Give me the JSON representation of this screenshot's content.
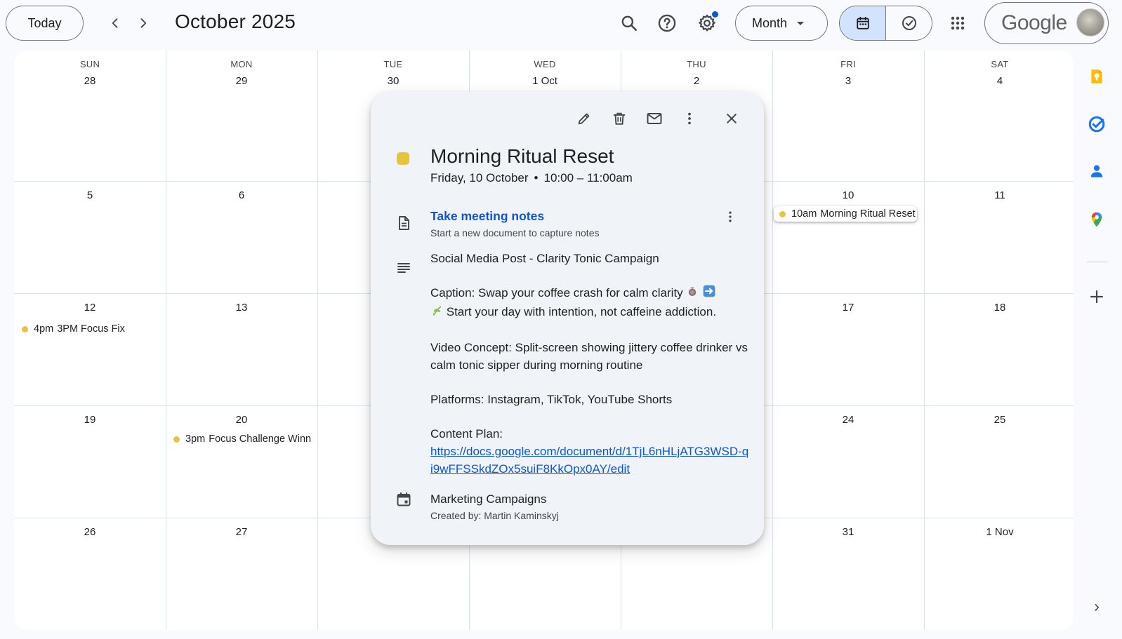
{
  "header": {
    "today_label": "Today",
    "month_title": "October 2025",
    "view_label": "Month",
    "google_label": "Google"
  },
  "calendar": {
    "weekdays": [
      "SUN",
      "MON",
      "TUE",
      "WED",
      "THU",
      "FRI",
      "SAT"
    ],
    "weeks": [
      [
        "28",
        "29",
        "30",
        "1 Oct",
        "2",
        "3",
        "4"
      ],
      [
        "5",
        "6",
        "",
        "",
        "",
        "10",
        "11"
      ],
      [
        "12",
        "13",
        "",
        "",
        "",
        "17",
        "18"
      ],
      [
        "19",
        "20",
        "",
        "",
        "",
        "24",
        "25"
      ],
      [
        "26",
        "27",
        "",
        "",
        "",
        "31",
        "1 Nov"
      ]
    ],
    "events": [
      {
        "time": "10am",
        "name": "Morning Ritual Reset",
        "color": "#e4c441"
      },
      {
        "time": "4pm",
        "name": "3PM Focus Fix",
        "color": "#e4c441"
      },
      {
        "time": "3pm",
        "name": "Focus Challenge Winner",
        "color": "#e4c441"
      }
    ]
  },
  "popover": {
    "title": "Morning Ritual Reset",
    "date": "Friday, 10 October",
    "separator": "•",
    "time_range": "10:00 – 11:00am",
    "color": "#e4c441",
    "notes_link": "Take meeting notes",
    "notes_sub": "Start a new document to capture notes",
    "description": {
      "line1": "Social Media Post - Clarity Tonic Campaign",
      "caption_a": "Caption: Swap your coffee crash for calm clarity",
      "caption_b": "Start your day with intention, not caffeine addiction.",
      "video": "Video Concept: Split-screen showing jittery coffee drinker vs calm tonic sipper during morning routine",
      "platforms": "Platforms: Instagram, TikTok, YouTube Shorts",
      "content_plan_label": "Content Plan:",
      "content_plan_url": "https://docs.google.com/document/d/1TjL6nHLjATG3WSD-qi9wFFSSkdZOx5suiF8KkOpx0AY/edit"
    },
    "calendar_name": "Marketing Campaigns",
    "created_by": "Created by: Martin Kaminskyj"
  }
}
